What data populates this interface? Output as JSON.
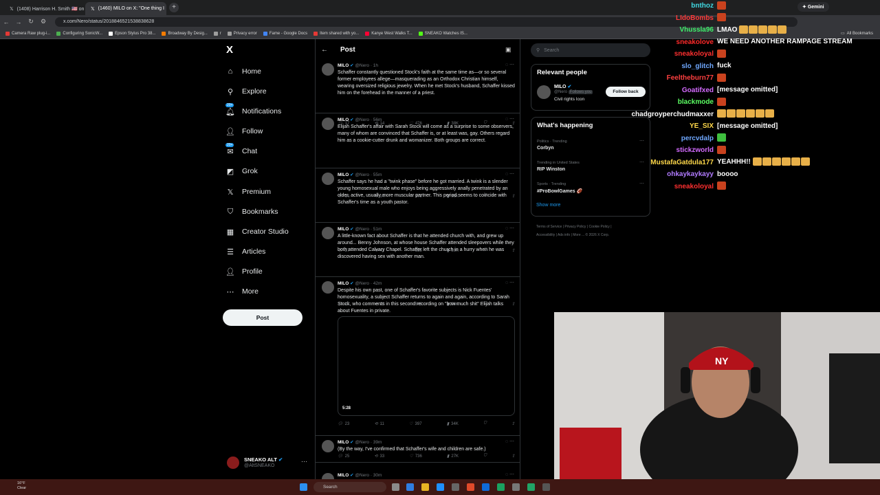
{
  "browser": {
    "tabs": [
      {
        "label": "(1408) Harrison H. Smith 🇺🇸 on X",
        "active": false
      },
      {
        "label": "(1460) MILO on X: \"One thing I",
        "active": true
      }
    ],
    "new_tab": "+",
    "gemini_label": "Gemini",
    "url": "x.com/Nero/status/2018846521538838628",
    "bookmarks": [
      "Camera Raw plug-i...",
      "Configuring SonicW...",
      "Epson Stylus Pro 38...",
      "Broadway By Desig...",
      "r",
      "Privacy error",
      "Fame - Google Docs",
      "Item shared with yo...",
      "Kanye West Walks T...",
      "SNEAKO Watches IS..."
    ],
    "all_bookmarks": "All Bookmarks"
  },
  "x": {
    "logo": "X",
    "nav": [
      {
        "label": "Home",
        "icon": "home-icon",
        "badge": ""
      },
      {
        "label": "Explore",
        "icon": "search-icon",
        "badge": ""
      },
      {
        "label": "Notifications",
        "icon": "bell-icon",
        "badge": "20+"
      },
      {
        "label": "Follow",
        "icon": "follow-icon",
        "badge": ""
      },
      {
        "label": "Chat",
        "icon": "chat-icon",
        "badge": "20+"
      },
      {
        "label": "Grok",
        "icon": "grok-icon",
        "badge": ""
      },
      {
        "label": "Premium",
        "icon": "x-icon",
        "badge": ""
      },
      {
        "label": "Bookmarks",
        "icon": "bookmark-icon",
        "badge": ""
      },
      {
        "label": "Creator Studio",
        "icon": "creator-icon",
        "badge": ""
      },
      {
        "label": "Articles",
        "icon": "articles-icon",
        "badge": ""
      },
      {
        "label": "Profile",
        "icon": "profile-icon",
        "badge": ""
      },
      {
        "label": "More",
        "icon": "more-icon",
        "badge": ""
      }
    ],
    "post_button": "Post",
    "account": {
      "name": "SNEAKO ALT",
      "handle": "@AltSNEAKO"
    }
  },
  "feed": {
    "title": "Post",
    "tweets": [
      {
        "name": "MILO",
        "handle": "@Nero · 1h",
        "text": "Schaffer constantly questioned Stock's faith at the same time as—or so several former employees allege—masquerading as an Orthodox Christian himself, wearing oversized religious jewelry. When he met Stock's husband, Schaffer kissed him on the forehead in the manner of a priest.",
        "replies": "17",
        "reposts": "14",
        "likes": "476",
        "views": "38K"
      },
      {
        "name": "MILO",
        "handle": "@Nero · 56m",
        "text": "Elijah Schaffer's affair with Sarah Stock will come as a surprise to some observers, many of whom are convinced that Schaffer is, or at least was, gay. Others regard him as a cookie-cutter drunk and womanizer. Both groups are correct.",
        "replies": "14",
        "reposts": "14",
        "likes": "572",
        "views": "35K"
      },
      {
        "name": "MILO",
        "handle": "@Nero · 55m",
        "text": "Schaffer says he had a \"twink phase\" before he got married. A twink is a slender young homosexual male who enjoys being aggressively anally penetrated by an older, active, usually more muscular partner. This period seems to coincide with Schaffer's time as a youth pastor.",
        "replies": "37",
        "reposts": "42",
        "likes": "555",
        "views": "39K"
      },
      {
        "name": "MILO",
        "handle": "@Nero · 51m",
        "text": "A little-known fact about Schaffer is that he attended church with, and grew up around... Benny Johnson, at whose house Schaffer attended sleepovers while they both attended Calvary Chapel. Schaffer left the church in a hurry when he was discovered having sex with another man.",
        "replies": "27",
        "reposts": "28",
        "likes": "549",
        "views": "36K"
      },
      {
        "name": "MILO",
        "handle": "@Nero · 42m",
        "text": "Despite his own past, one of Schaffer's favorite subjects is Nick Fuentes' homosexuality, a subject Schaffer returns to again and again, according to Sarah Stock, who comments in this second recording on \"how much shit\" Elijah talks about Fuentes in private.",
        "video_time": "5:28",
        "replies": "23",
        "reposts": "11",
        "likes": "397",
        "views": "34K"
      },
      {
        "name": "MILO",
        "handle": "@Nero · 39m",
        "text": "(By the way, I've confirmed that Schaffer's wife and children are safe.)",
        "replies": "25",
        "reposts": "33",
        "likes": "736",
        "views": "27K"
      },
      {
        "name": "MILO",
        "handle": "@Nero · 30m",
        "text": "",
        "replies": "",
        "reposts": "",
        "likes": "",
        "views": ""
      }
    ]
  },
  "sidebar": {
    "search_placeholder": "Search",
    "relevant_title": "Relevant people",
    "relevant": {
      "name": "MILO",
      "handle": "@Nero",
      "follows_you": "Follows you",
      "bio": "Civil rights Icon",
      "button": "Follow back"
    },
    "happening_title": "What's happening",
    "trends": [
      {
        "category": "Politics · Trending",
        "name": "Corbyn"
      },
      {
        "category": "Trending in United States",
        "name": "RIP Winston"
      },
      {
        "category": "Sports · Trending",
        "name": "#ProBowlGames 🏈"
      }
    ],
    "show_more": "Show more",
    "footer": [
      "Terms of Service",
      "Privacy Policy",
      "Cookie Policy",
      "Accessibility",
      "Ads info",
      "More ...",
      "© 2026 X Corp."
    ]
  },
  "chat": [
    {
      "user": "bnthoz",
      "color": "#40d7e0",
      "message": ""
    },
    {
      "user": "LIdoBombs",
      "color": "#ff3b3b",
      "message": ""
    },
    {
      "user": "Vhussla96",
      "color": "#3ef06b",
      "message": "LMAO"
    },
    {
      "user": "sneakolove",
      "color": "#ff2a2a",
      "message": "WE NEED ANOTHER RAMPAGE STREAM"
    },
    {
      "user": "sneakoloyal",
      "color": "#ff3030",
      "message": ""
    },
    {
      "user": "slo_glitch",
      "color": "#6fa8ff",
      "message": "fuck"
    },
    {
      "user": "Feeltheburn77",
      "color": "#ff4040",
      "message": ""
    },
    {
      "user": "Goatifxed",
      "color": "#d46bff",
      "message": "[message omitted]"
    },
    {
      "user": "blackmode",
      "color": "#5cff63",
      "message": ""
    },
    {
      "user": "chadgroyperchudmaxxer",
      "color": "#ffffff",
      "message": ""
    },
    {
      "user": "YE_SIX",
      "color": "#ffd84a",
      "message": "[message omitted]"
    },
    {
      "user": "percvdalp",
      "color": "#6fa8ff",
      "message": ""
    },
    {
      "user": "stickzworld",
      "color": "#d46bff",
      "message": ""
    },
    {
      "user": "MustafaGatdula177",
      "color": "#ffd84a",
      "message": "YEAHHH!!"
    },
    {
      "user": "ohkaykaykayy",
      "color": "#b17bff",
      "message": "boooo"
    },
    {
      "user": "sneakoloyal",
      "color": "#ff3030",
      "message": ""
    }
  ],
  "taskbar": {
    "weather_temp": "16°F",
    "weather_desc": "Clear",
    "search_placeholder": "Search"
  },
  "colors": {
    "x_accent": "#1d9bf0",
    "taskbar": "#3e1713"
  }
}
